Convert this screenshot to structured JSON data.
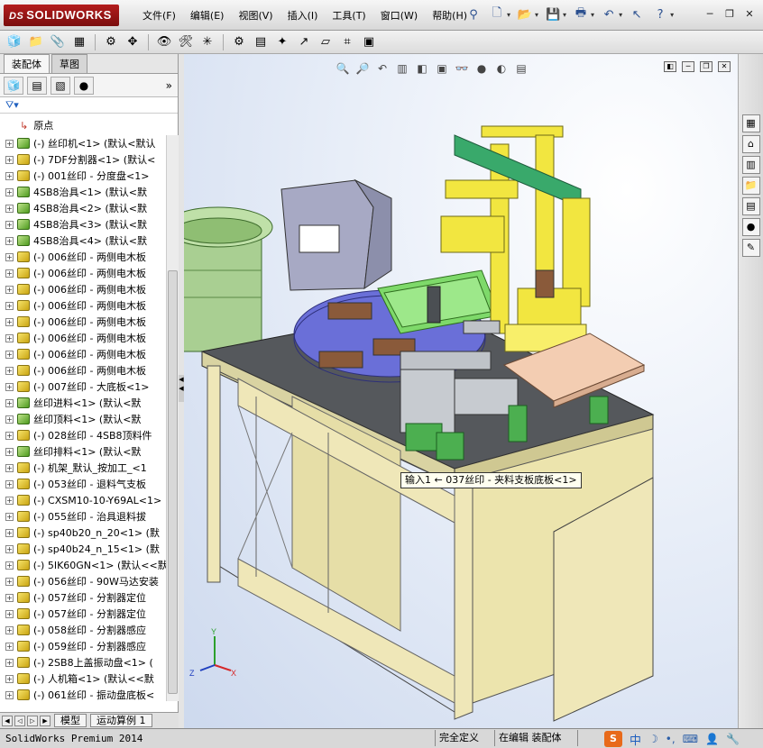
{
  "app": {
    "logo": "SOLIDWORKS",
    "logo_prefix": "DS"
  },
  "menu": [
    "文件(F)",
    "编辑(E)",
    "视图(V)",
    "插入(I)",
    "工具(T)",
    "窗口(W)",
    "帮助(H)"
  ],
  "panel": {
    "tabs": [
      "装配体",
      "草图"
    ],
    "origin": "原点",
    "tree": [
      {
        "text": "(-) 丝印机<1> (默认<默认",
        "c": "g"
      },
      {
        "text": "(-) 7DF分割器<1> (默认<",
        "c": "y"
      },
      {
        "text": "(-) 001丝印 - 分度盘<1>",
        "c": "y"
      },
      {
        "text": "4SB8治具<1> (默认<默",
        "c": "g"
      },
      {
        "text": "4SB8治具<2> (默认<默",
        "c": "g"
      },
      {
        "text": "4SB8治具<3> (默认<默",
        "c": "g"
      },
      {
        "text": "4SB8治具<4> (默认<默",
        "c": "g"
      },
      {
        "text": "(-) 006丝印 - 两侧电木板",
        "c": "y"
      },
      {
        "text": "(-) 006丝印 - 两侧电木板",
        "c": "y"
      },
      {
        "text": "(-) 006丝印 - 两侧电木板",
        "c": "y"
      },
      {
        "text": "(-) 006丝印 - 两侧电木板",
        "c": "y"
      },
      {
        "text": "(-) 006丝印 - 两侧电木板",
        "c": "y"
      },
      {
        "text": "(-) 006丝印 - 两侧电木板",
        "c": "y"
      },
      {
        "text": "(-) 006丝印 - 两侧电木板",
        "c": "y"
      },
      {
        "text": "(-) 006丝印 - 两侧电木板",
        "c": "y"
      },
      {
        "text": "(-) 007丝印 - 大底板<1>",
        "c": "y"
      },
      {
        "text": "丝印进料<1> (默认<默",
        "c": "g"
      },
      {
        "text": "丝印顶料<1> (默认<默",
        "c": "g"
      },
      {
        "text": "(-) 028丝印 - 4SB8顶料件",
        "c": "y"
      },
      {
        "text": "丝印排料<1> (默认<默",
        "c": "g"
      },
      {
        "text": "(-) 机架_默认_按加工_<1",
        "c": "y"
      },
      {
        "text": "(-) 053丝印 - 退料气支板",
        "c": "y"
      },
      {
        "text": "(-) CXSM10-10-Y69AL<1>",
        "c": "y"
      },
      {
        "text": "(-) 055丝印 - 治具退料拔",
        "c": "y"
      },
      {
        "text": "(-) sp40b20_n_20<1> (默",
        "c": "y"
      },
      {
        "text": "(-) sp40b24_n_15<1> (默",
        "c": "y"
      },
      {
        "text": "(-) 5IK60GN<1> (默认<<默",
        "c": "y"
      },
      {
        "text": "(-) 056丝印 - 90W马达安装",
        "c": "y"
      },
      {
        "text": "(-) 057丝印 - 分割器定位",
        "c": "y"
      },
      {
        "text": "(-) 057丝印 - 分割器定位",
        "c": "y"
      },
      {
        "text": "(-) 058丝印 - 分割器感应",
        "c": "y"
      },
      {
        "text": "(-) 059丝印 - 分割器感应",
        "c": "y"
      },
      {
        "text": "(-) 2SB8上盖振动盘<1> (",
        "c": "y"
      },
      {
        "text": "(-) 人机箱<1> (默认<<默",
        "c": "y"
      },
      {
        "text": "(-) 061丝印 - 振动盘底板<",
        "c": "y"
      }
    ],
    "bottom_tabs": [
      "模型",
      "运动算例 1"
    ]
  },
  "viewport": {
    "tooltip": "输入1 ← 037丝印 - 夹料支板底板<1>"
  },
  "status": {
    "product": "SolidWorks Premium 2014",
    "state": "完全定义",
    "mode": "在编辑 装配体",
    "ime": "中"
  }
}
